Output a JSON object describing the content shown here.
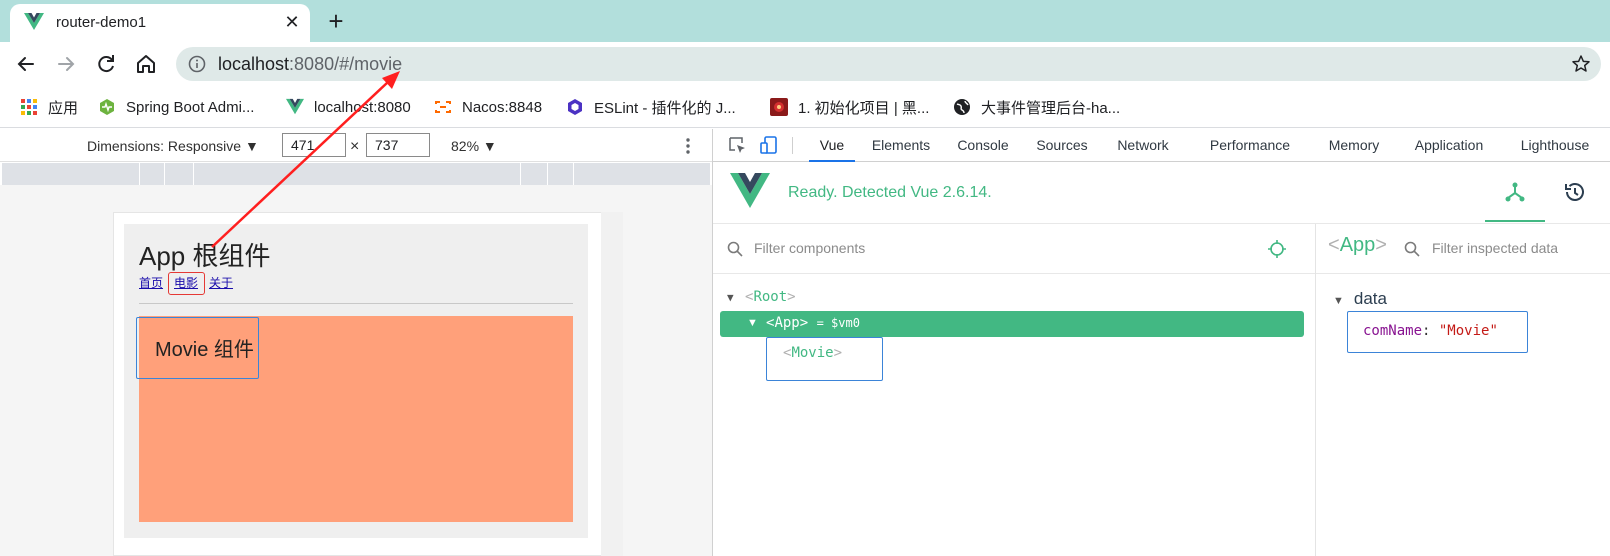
{
  "browser": {
    "tab_title": "router-demo1",
    "url_host": "localhost",
    "url_rest": ":8080/#/movie",
    "bookmarks": [
      {
        "label": "应用",
        "icon": "apps-grid-icon"
      },
      {
        "label": "Spring Boot Admi...",
        "icon": "spring-boot-admin-icon"
      },
      {
        "label": "localhost:8080",
        "icon": "vue-icon"
      },
      {
        "label": "Nacos:8848",
        "icon": "nacos-icon"
      },
      {
        "label": "ESLint - 插件化的 J...",
        "icon": "eslint-icon"
      },
      {
        "label": "1. 初始化项目 | 黑...",
        "icon": "project-icon"
      },
      {
        "label": "大事件管理后台-ha...",
        "icon": "globe-icon"
      }
    ]
  },
  "device_toolbar": {
    "dimensions_label": "Dimensions: Responsive ▼",
    "width": "471",
    "height": "737",
    "times": "×",
    "zoom": "82% ▼"
  },
  "emulated_page": {
    "app_title": "App 根组件",
    "links": [
      "首页",
      "电影",
      "关于"
    ],
    "movie_title": "Movie 组件",
    "movie_bg_color": "#ffa07a"
  },
  "devtools": {
    "tabs": [
      "Vue",
      "Elements",
      "Console",
      "Sources",
      "Network",
      "Performance",
      "Memory",
      "Application",
      "Lighthouse"
    ],
    "active_tab": "Vue",
    "ready_text": "Ready. Detected Vue 2.6.14.",
    "filter_placeholder": "Filter components",
    "tree": {
      "root": "Root",
      "app": "App",
      "app_vm": "= $vm0",
      "movie": "Movie"
    },
    "inspector": {
      "selected": "App",
      "filter_placeholder": "Filter inspected data",
      "section": "data",
      "prop_key": "comName",
      "prop_value": "\"Movie\""
    },
    "accent_color": "#42b883"
  }
}
